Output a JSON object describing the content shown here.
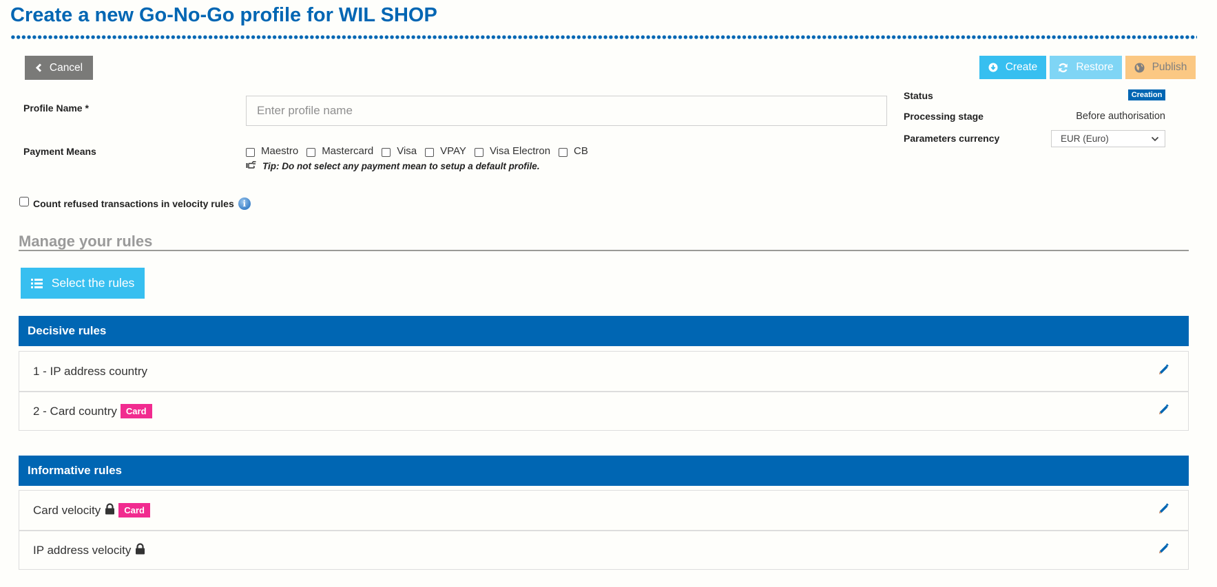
{
  "page": {
    "title": "Create a new Go-No-Go profile for WIL SHOP"
  },
  "toolbar": {
    "cancel_label": "Cancel",
    "cancel_icon": "chevron-left-icon",
    "create_label": "Create",
    "create_icon": "circle-arrow-down-icon",
    "restore_label": "Restore",
    "restore_icon": "refresh-icon",
    "publish_label": "Publish",
    "publish_icon": "globe-icon"
  },
  "form": {
    "profile_name_label": "Profile Name *",
    "profile_name_value": "",
    "profile_name_placeholder": "Enter profile name",
    "payment_means_label": "Payment Means",
    "payment_means": [
      {
        "label": "Maestro",
        "checked": false
      },
      {
        "label": "Mastercard",
        "checked": false
      },
      {
        "label": "Visa",
        "checked": false
      },
      {
        "label": "VPAY",
        "checked": false
      },
      {
        "label": "Visa Electron",
        "checked": false
      },
      {
        "label": "CB",
        "checked": false
      }
    ],
    "tip": "Tip: Do not select any payment mean to setup a default profile.",
    "count_refused_label": "Count refused transactions in velocity rules",
    "count_refused_checked": false
  },
  "sidebar": {
    "status_label": "Status",
    "status_value": "Creation",
    "stage_label": "Processing stage",
    "stage_value": "Before authorisation",
    "currency_label": "Parameters currency",
    "currency_value": "EUR (Euro)"
  },
  "rules": {
    "manage_title": "Manage your rules",
    "select_label": "Select the rules",
    "decisive": {
      "title": "Decisive rules",
      "items": [
        {
          "name": "1 - IP address country",
          "locked": false,
          "tag": null
        },
        {
          "name": "2 - Card country",
          "locked": false,
          "tag": "Card"
        }
      ]
    },
    "informative": {
      "title": "Informative rules",
      "items": [
        {
          "name": "Card velocity",
          "locked": true,
          "tag": "Card"
        },
        {
          "name": "IP address velocity",
          "locked": true,
          "tag": null
        }
      ]
    }
  },
  "colors": {
    "brand": "#0066b3",
    "primary_button": "#37bff0",
    "restore_button": "#7fd5f5",
    "publish_button": "#fbc883",
    "cancel_button": "#7a7a78",
    "tag": "#f12b8f"
  }
}
